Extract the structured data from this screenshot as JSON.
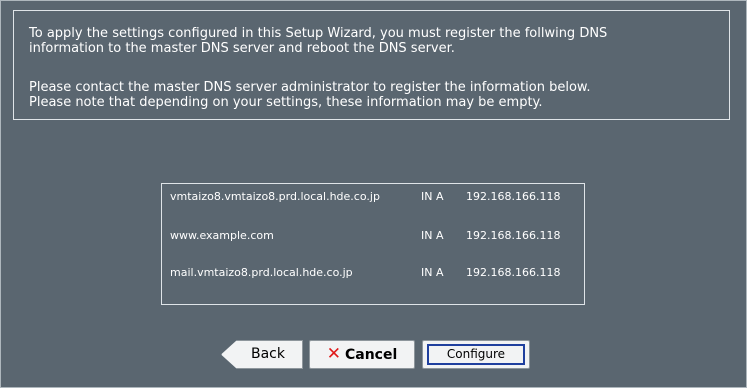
{
  "message": {
    "line1": "To apply the settings configured in this Setup Wizard, you must register the follwing DNS",
    "line2": "information to the master DNS server and reboot the DNS server.",
    "line3": "Please contact the master DNS server administrator to register the information below.",
    "line4": "Please note that depending on your settings, these information may be empty."
  },
  "records": [
    {
      "host": "vmtaizo8.vmtaizo8.prd.local.hde.co.jp",
      "type": "IN A",
      "address": "192.168.166.118"
    },
    {
      "host": "www.example.com",
      "type": "IN A",
      "address": "192.168.166.118"
    },
    {
      "host": "mail.vmtaizo8.prd.local.hde.co.jp",
      "type": "IN A",
      "address": "192.168.166.118"
    }
  ],
  "buttons": {
    "back_label": "Back",
    "cancel_label": "Cancel",
    "cancel_icon": "close-icon",
    "configure_label": "Configure"
  },
  "colors": {
    "panel_background": "#5a6670",
    "cancel_icon": "#e01a1a",
    "focus_ring": "#1f3f9e"
  }
}
